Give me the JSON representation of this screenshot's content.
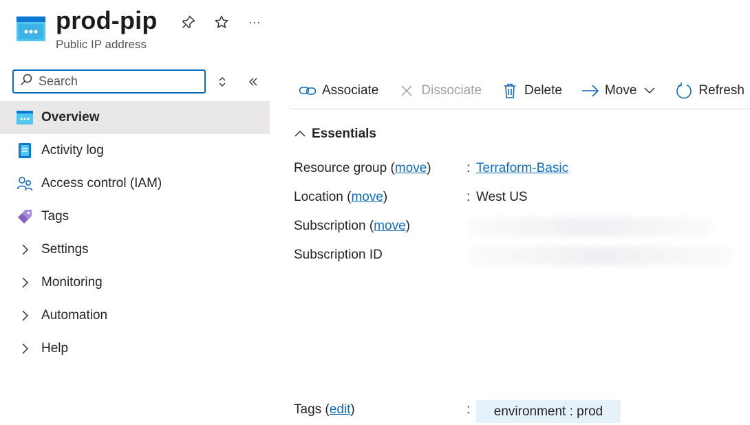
{
  "header": {
    "title": "prod-pip",
    "subtitle": "Public IP address",
    "more_label": "···"
  },
  "sidebar": {
    "search": {
      "placeholder": "Search",
      "value": ""
    },
    "items": [
      {
        "label": "Overview",
        "icon": "public-ip-icon",
        "active": true
      },
      {
        "label": "Activity log",
        "icon": "activity-log-icon"
      },
      {
        "label": "Access control (IAM)",
        "icon": "people-icon"
      },
      {
        "label": "Tags",
        "icon": "tag-icon"
      },
      {
        "label": "Settings",
        "icon": "chevron-right-icon"
      },
      {
        "label": "Monitoring",
        "icon": "chevron-right-icon"
      },
      {
        "label": "Automation",
        "icon": "chevron-right-icon"
      },
      {
        "label": "Help",
        "icon": "chevron-right-icon"
      }
    ]
  },
  "toolbar": {
    "associate": "Associate",
    "dissociate": "Dissociate",
    "delete": "Delete",
    "move": "Move",
    "refresh": "Refresh"
  },
  "essentials": {
    "title": "Essentials",
    "rows": {
      "resource_group": {
        "label": "Resource group (",
        "link": "move",
        "close": ")",
        "colon": ":",
        "value": "Terraform-Basic"
      },
      "location": {
        "label": "Location (",
        "link": "move",
        "close": ")",
        "colon": ":",
        "value": "West US"
      },
      "subscription": {
        "label": "Subscription (",
        "link": "move",
        "close": ")"
      },
      "subscription_id": {
        "label": "Subscription ID"
      },
      "tags": {
        "label": "Tags (",
        "link": "edit",
        "close": ")",
        "colon": ":",
        "value": "environment : prod"
      }
    }
  },
  "colors": {
    "accent": "#0f6cbd",
    "active_nav_bg": "#e9e8e7",
    "tag_bg": "#e6f2fb"
  }
}
